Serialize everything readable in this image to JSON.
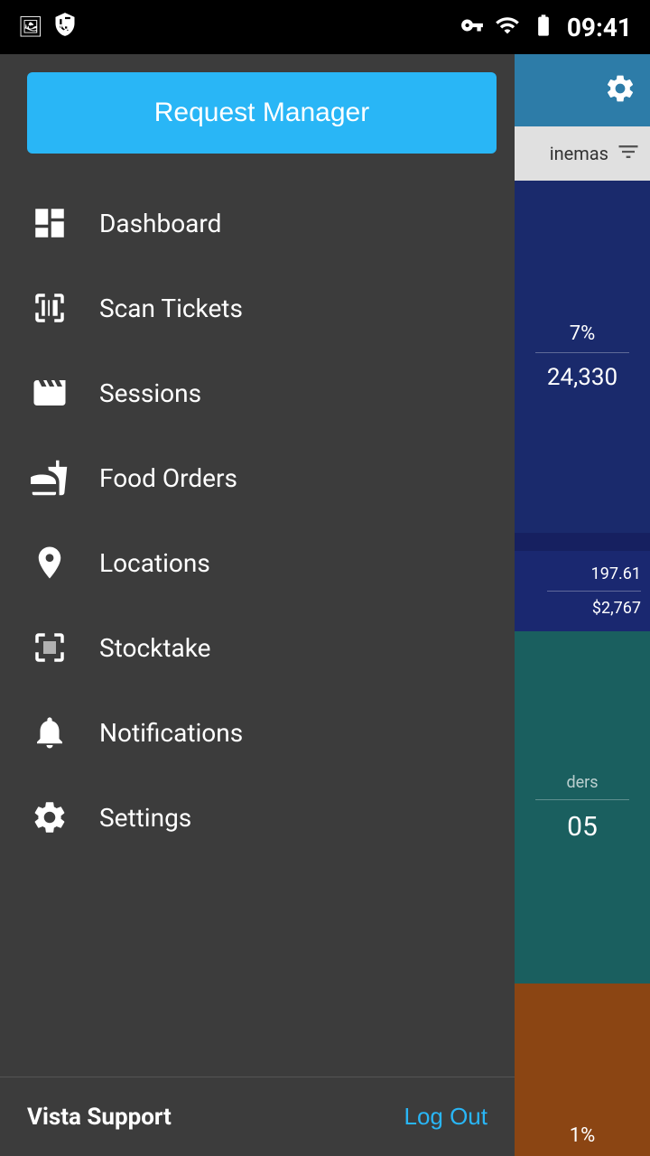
{
  "statusBar": {
    "time": "09:41",
    "icons": [
      "photo-icon",
      "shield-icon",
      "key-icon",
      "wifi-icon",
      "battery-icon"
    ]
  },
  "drawer": {
    "requestManagerLabel": "Request Manager",
    "navItems": [
      {
        "id": "dashboard",
        "label": "Dashboard",
        "icon": "dashboard-icon"
      },
      {
        "id": "scan-tickets",
        "label": "Scan Tickets",
        "icon": "scan-icon"
      },
      {
        "id": "sessions",
        "label": "Sessions",
        "icon": "film-icon"
      },
      {
        "id": "food-orders",
        "label": "Food Orders",
        "icon": "food-icon"
      },
      {
        "id": "locations",
        "label": "Locations",
        "icon": "location-icon"
      },
      {
        "id": "stocktake",
        "label": "Stocktake",
        "icon": "stocktake-icon"
      },
      {
        "id": "notifications",
        "label": "Notifications",
        "icon": "bell-icon"
      },
      {
        "id": "settings",
        "label": "Settings",
        "icon": "settings-icon"
      }
    ],
    "footer": {
      "supportLabel": "Vista Support",
      "logoutLabel": "Log Out"
    }
  },
  "rightPanel": {
    "filterLabel": "inemas",
    "card1": {
      "percent": "7%",
      "value": "24,330"
    },
    "card2": {
      "value1": "197.61",
      "value2": "$2,767"
    },
    "card3": {
      "label": "ders",
      "value": "05"
    },
    "card4": {
      "percent": "1%"
    }
  },
  "colors": {
    "accent": "#29b6f6",
    "drawerBg": "#3c3c3c",
    "rightPanelBg": "#1a2a6c"
  }
}
